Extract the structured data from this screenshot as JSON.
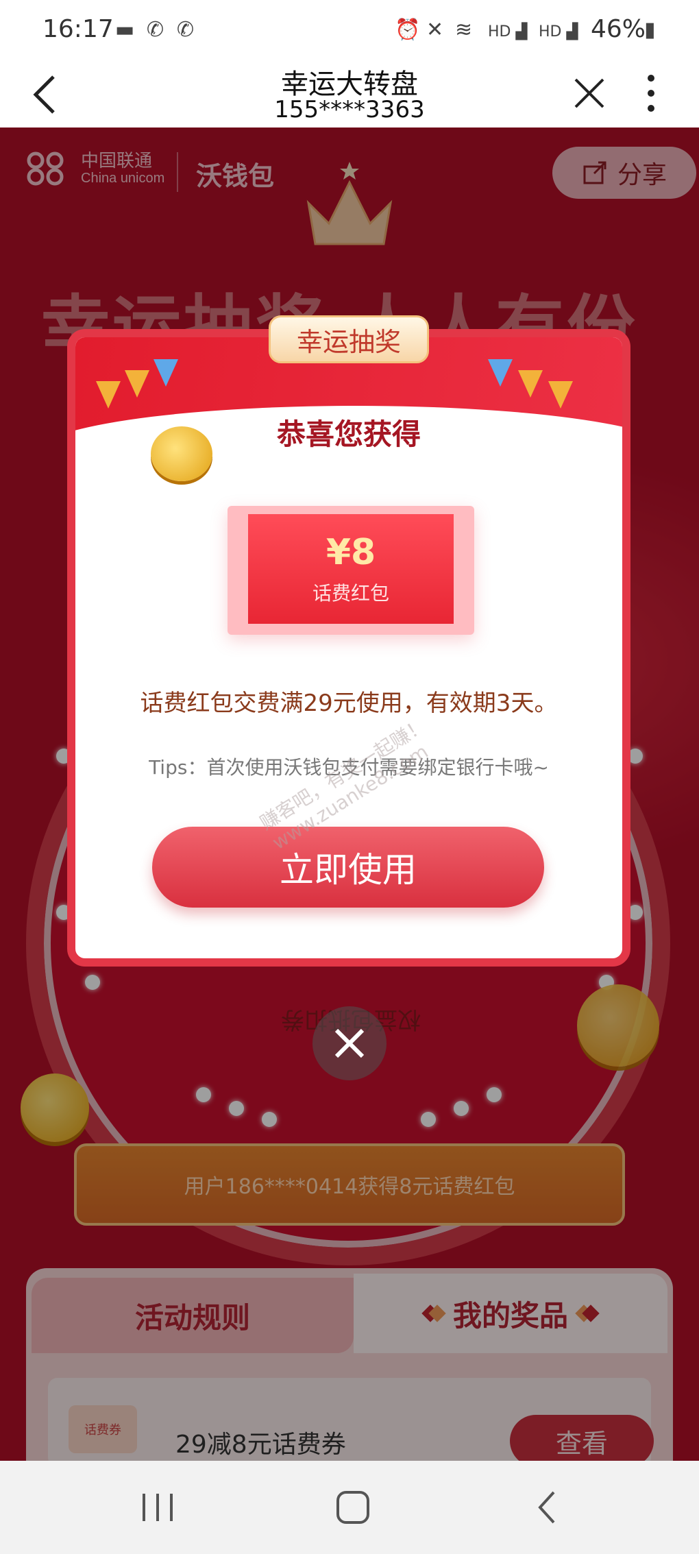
{
  "status_bar": {
    "time": "16:17",
    "battery": "46%"
  },
  "titlebar": {
    "title": "幸运大转盘",
    "subtitle": "155****3363"
  },
  "header": {
    "brand_cn": "中国联通",
    "brand_en": "China unicom",
    "wallet": "沃钱包",
    "share": "分享"
  },
  "background": {
    "slogan": "幸运抽奖 人人有份",
    "wheel_prize": "权益包抵扣券"
  },
  "modal": {
    "tag": "幸运抽奖",
    "title": "恭喜您获得",
    "coupon_amount": "¥8",
    "coupon_label": "话费红包",
    "description": "话费红包交费满29元使用，有效期3天。",
    "tips": "Tips：首次使用沃钱包支付需要绑定银行卡哦~",
    "use_button": "立即使用"
  },
  "watermark": {
    "line1": "赚客吧，有奖一起赚！",
    "line2": "www.zuanke8.com"
  },
  "ticker": {
    "text": "用户186****0414获得8元话费红包"
  },
  "tabs": {
    "rules": "活动规则",
    "prizes": "我的奖品"
  },
  "prize_list": [
    {
      "icon_text": "话费券",
      "name": "29减8元话费券",
      "button": "查看"
    }
  ],
  "colors": {
    "primary_red": "#b20f28",
    "modal_border": "#e33747",
    "button_red": "#d9303f",
    "gold": "#e7a30f"
  }
}
